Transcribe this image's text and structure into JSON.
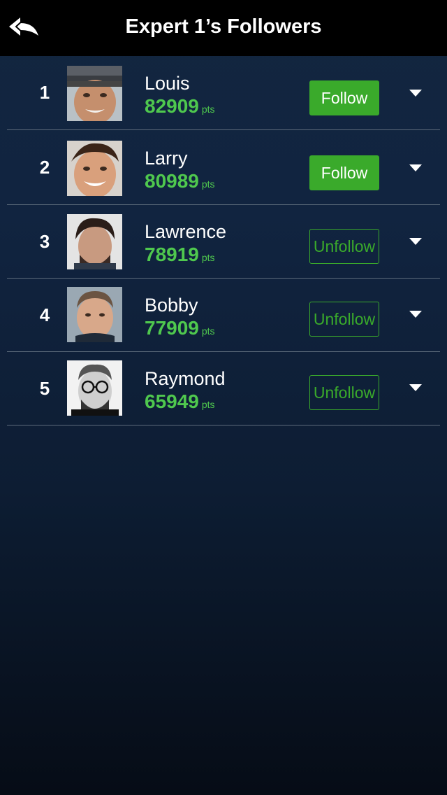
{
  "header": {
    "title": "Expert 1’s Followers",
    "back_icon": "reply-back-arrow-icon"
  },
  "colors": {
    "header_bg": "#000000",
    "accent_green": "#3aaa2b",
    "score_green": "#4fc84e"
  },
  "followers": [
    {
      "rank": "1",
      "name": "Louis",
      "score": "82909",
      "unit": "pts",
      "action": "Follow",
      "state": "follow"
    },
    {
      "rank": "2",
      "name": "Larry",
      "score": "80989",
      "unit": "pts",
      "action": "Follow",
      "state": "follow"
    },
    {
      "rank": "3",
      "name": "Lawrence",
      "score": "78919",
      "unit": "pts",
      "action": "Unfollow",
      "state": "unfollow"
    },
    {
      "rank": "4",
      "name": "Bobby",
      "score": "77909",
      "unit": "pts",
      "action": "Unfollow",
      "state": "unfollow"
    },
    {
      "rank": "5",
      "name": "Raymond",
      "score": "65949",
      "unit": "pts",
      "action": "Unfollow",
      "state": "unfollow"
    }
  ]
}
